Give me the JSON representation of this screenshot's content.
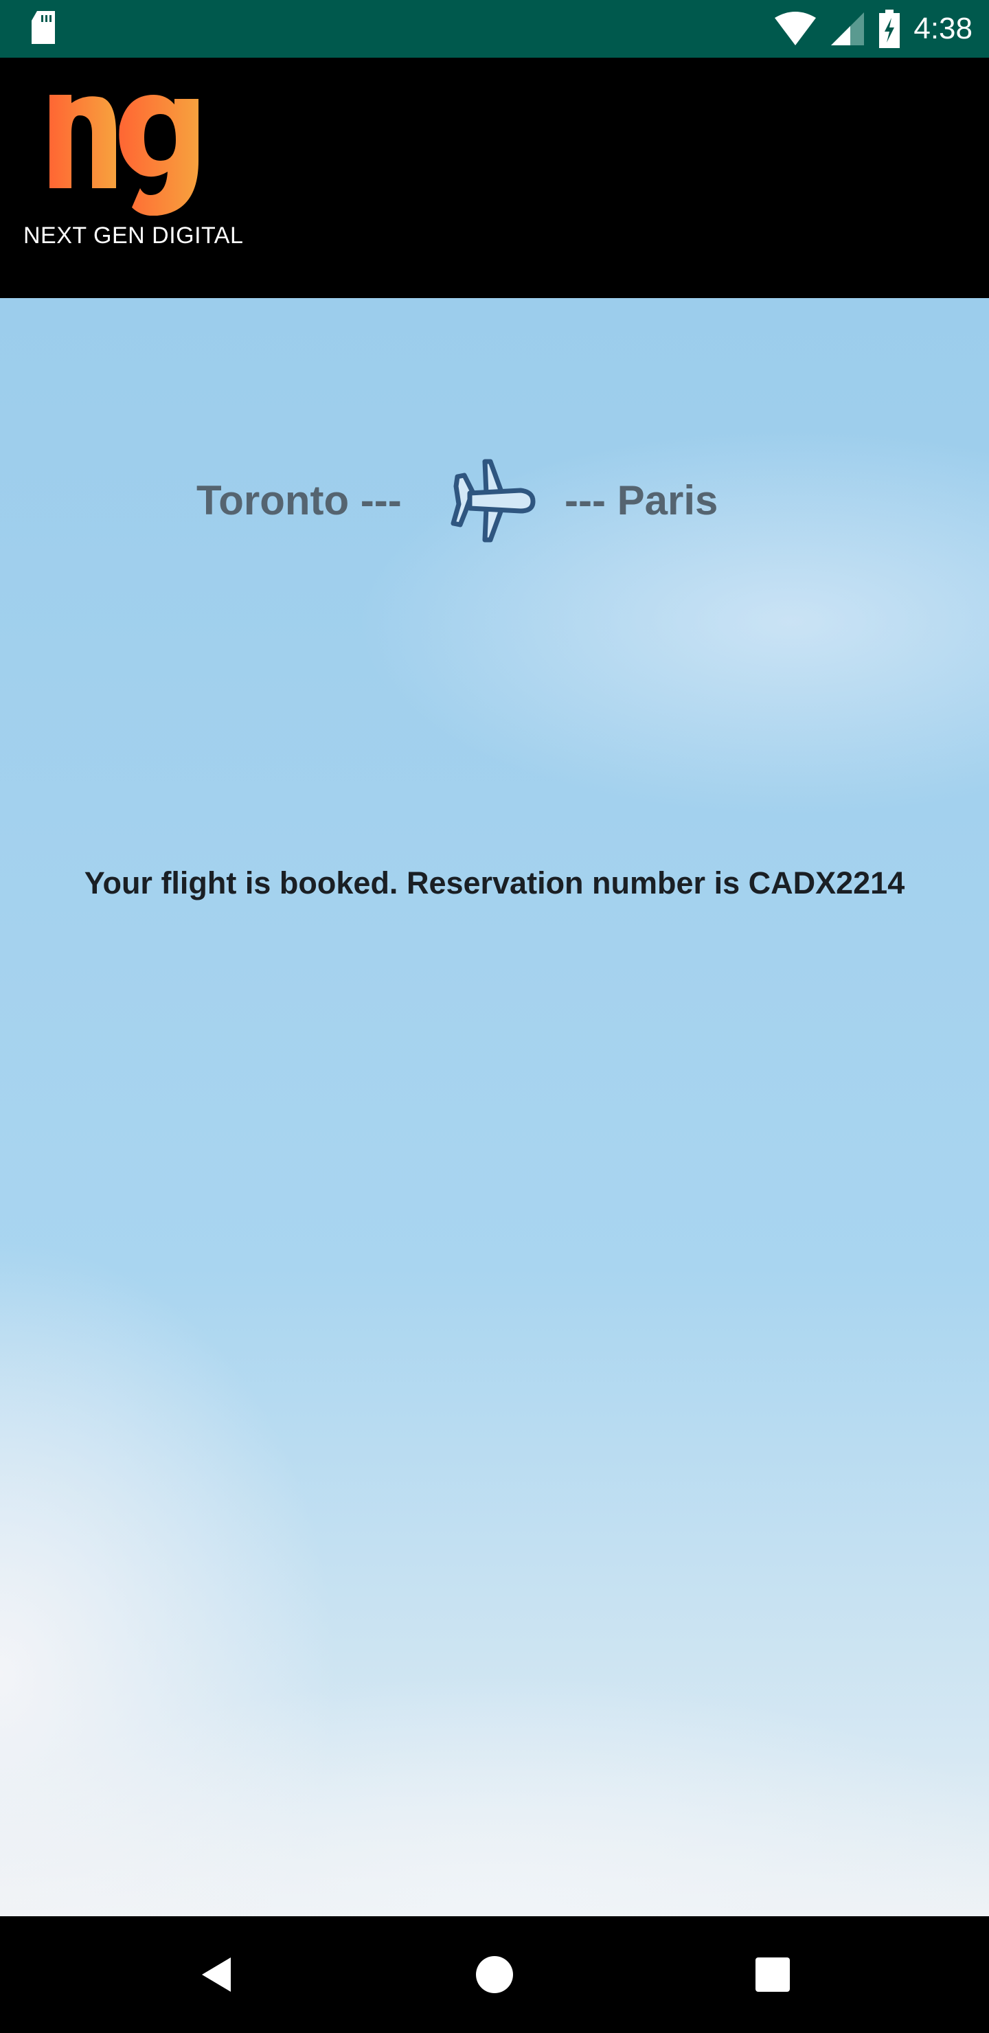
{
  "status_bar": {
    "time": "4:38",
    "icons": [
      "sd-card-icon",
      "wifi-icon",
      "signal-icon",
      "battery-charging-icon"
    ]
  },
  "header": {
    "logo_letters": "ng",
    "logo_text": "NEXT GEN DIGITAL",
    "logo_gradient": [
      "#ff6633",
      "#f7a23e"
    ]
  },
  "route": {
    "origin": "Toronto ---",
    "destination": "--- Paris",
    "icon": "airplane-icon"
  },
  "confirmation": {
    "message": "Your flight is booked. Reservation number is CADX2214"
  },
  "nav_bar": {
    "buttons": [
      "back",
      "home",
      "recents"
    ]
  }
}
